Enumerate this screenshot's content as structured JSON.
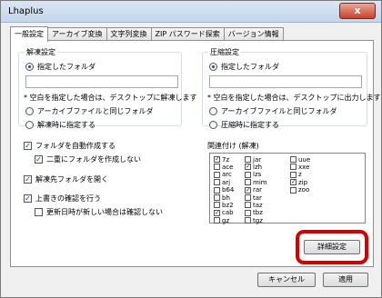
{
  "window": {
    "title": "Lhaplus",
    "close": "x"
  },
  "tabs": [
    "一般設定",
    "アーカイブ変換",
    "文字列変換",
    "ZIP パスワード探索",
    "バージョン情報"
  ],
  "extract": {
    "group_label": "解凍設定",
    "specified_folder": "指定したフォルダ",
    "path_value": "",
    "note": "* 空白を指定した場合は、デスクトップに解凍します",
    "same_as_archive": "アーカイブファイルと同じフォルダ",
    "ask_on_extract": "解凍時に指定する",
    "auto_create_folder": "フォルダを自動作成する",
    "no_double_folder": "二重にフォルダを作成しない",
    "open_dest_folder": "解凍先フォルダを開く",
    "confirm_overwrite": "上書きの確認を行う",
    "skip_if_newer": "更新日時が新しい場合は確認しない"
  },
  "compress": {
    "group_label": "圧縮設定",
    "specified_folder": "指定したフォルダ",
    "path_value": "",
    "note": "* 空白を指定した場合は、デスクトップに出力します",
    "same_as_archive": "アーカイブファイルと同じフォルダ",
    "ask_on_compress": "圧縮時に指定する"
  },
  "association": {
    "label": "関連付け (解凍)",
    "col1": [
      "7z",
      "ace",
      "arc",
      "arj",
      "b64",
      "bh",
      "bz2",
      "cab",
      "gz"
    ],
    "col2": [
      "jar",
      "lzh",
      "lzs",
      "mim",
      "rar",
      "tar",
      "taz",
      "tbz",
      "tgz"
    ],
    "col3": [
      "uue",
      "xxe",
      "z",
      "zip",
      "zoo"
    ],
    "checked": [
      "7z",
      "cab",
      "lzh",
      "rar",
      "zip"
    ]
  },
  "buttons": {
    "advanced": "詳細設定",
    "cancel": "キャンセル",
    "apply": "適用"
  }
}
